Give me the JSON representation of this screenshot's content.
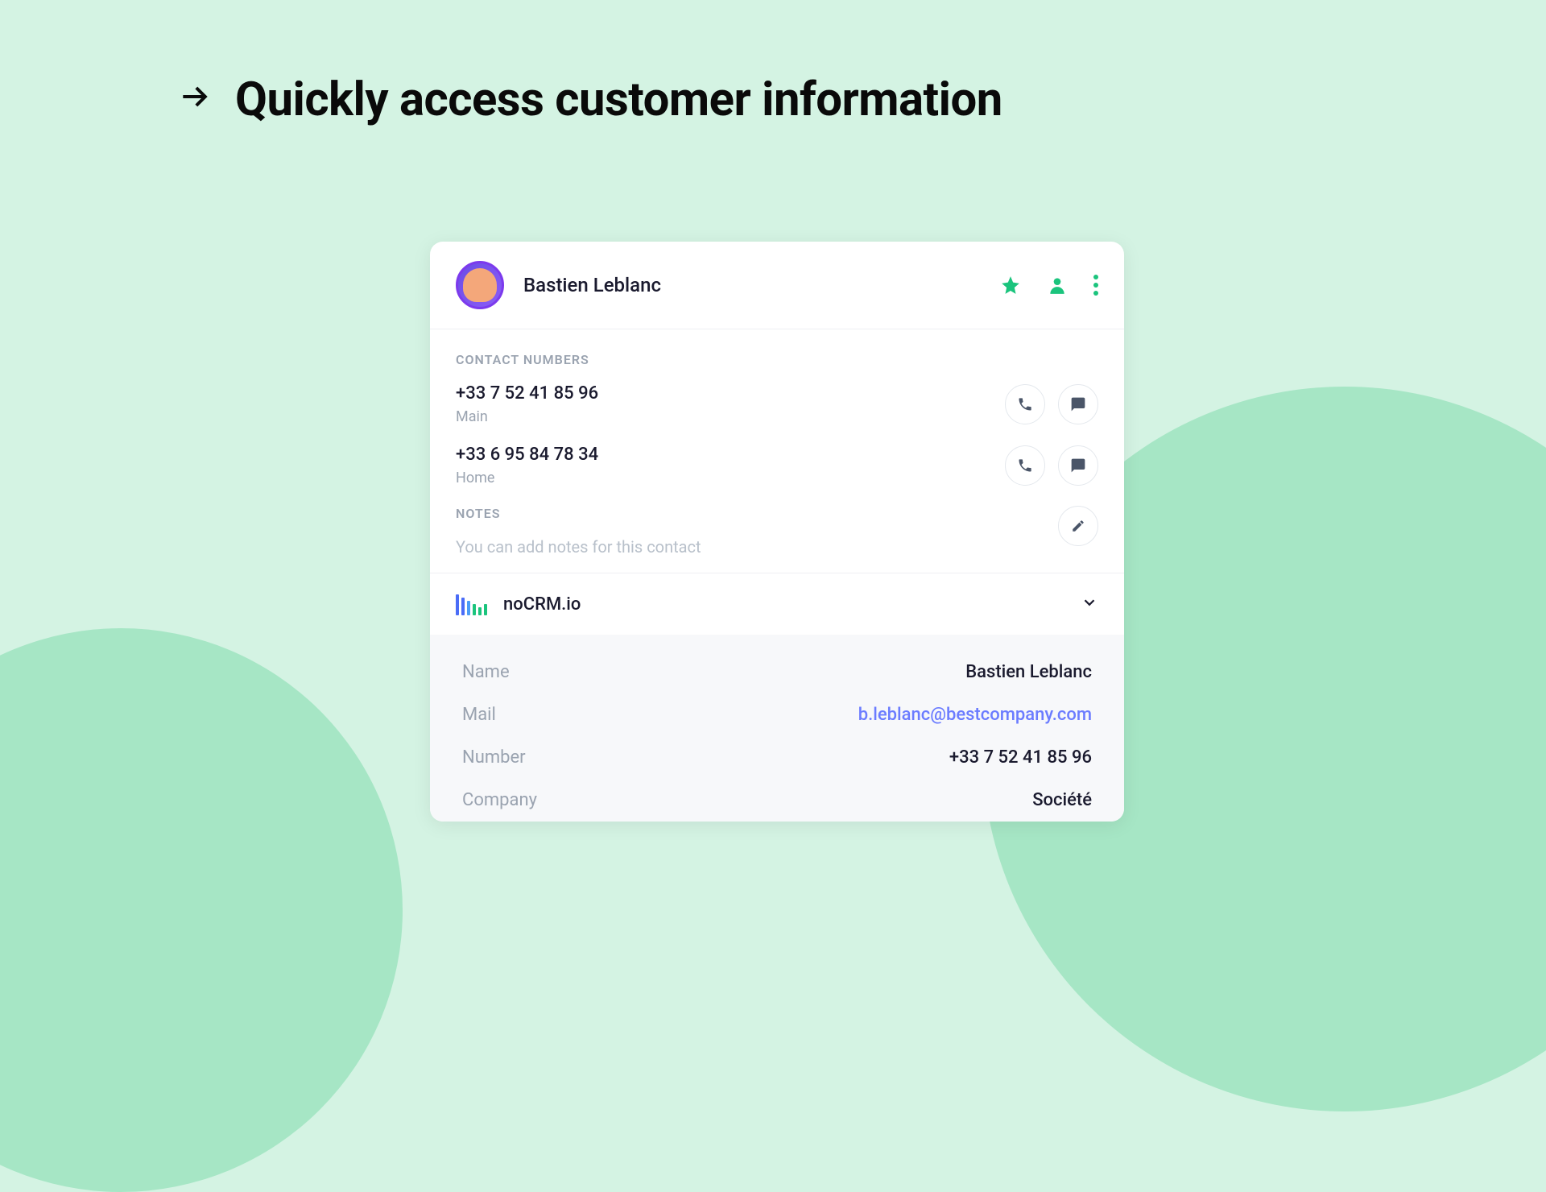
{
  "heading": "Quickly access customer information",
  "contact": {
    "name": "Bastien Leblanc",
    "numbers_section_label": "CONTACT NUMBERS",
    "phones": [
      {
        "number": "+33 7 52 41 85 96",
        "label": "Main"
      },
      {
        "number": "+33 6 95 84 78 34",
        "label": "Home"
      }
    ],
    "notes_section_label": "NOTES",
    "notes_placeholder": "You can add notes for this contact"
  },
  "crm": {
    "name": "noCRM.io",
    "fields": [
      {
        "label": "Name",
        "value": "Bastien Leblanc",
        "type": "text"
      },
      {
        "label": "Mail",
        "value": "b.leblanc@bestcompany.com",
        "type": "link"
      },
      {
        "label": "Number",
        "value": "+33 7 52 41 85 96",
        "type": "text"
      },
      {
        "label": "Company",
        "value": "Société",
        "type": "text"
      }
    ]
  },
  "colors": {
    "accent": "#1bc47d",
    "link": "#6b7cff"
  }
}
